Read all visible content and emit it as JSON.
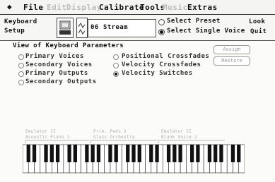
{
  "menu": {
    "apple": "◆",
    "items": [
      {
        "label": "File",
        "enabled": true
      },
      {
        "label": "Edit",
        "enabled": false
      },
      {
        "label": "Display",
        "enabled": false
      },
      {
        "label": "Calibrate",
        "enabled": true
      },
      {
        "label": "Tools",
        "enabled": true
      },
      {
        "label": "Music",
        "enabled": false
      },
      {
        "label": "Extras",
        "enabled": true
      }
    ]
  },
  "strip": {
    "setup_line1": "Keyboard",
    "setup_line2": "Setup",
    "stream_number": "06",
    "stream_label": "Stream",
    "select_preset": "Select Preset",
    "select_voice": "Select Single Voice",
    "voice_mode_selected": "single",
    "look_label": "Look",
    "quit_label": "Quit"
  },
  "panel": {
    "title": "View of Keyboard Parameters",
    "left_options": [
      "Primary Voices",
      "Secondary Voices",
      "Primary Outputs",
      "Secondary Outputs"
    ],
    "right_options": [
      "Positional Crossfades",
      "Velocity Crossfades",
      "Velocity Switches"
    ],
    "selected_option": "Velocity Switches",
    "buttons": [
      "Assign",
      "Restore"
    ]
  },
  "zones": [
    {
      "line1": "Emulator II",
      "line2": "Acoustic Piano 1"
    },
    {
      "line1": "Prim. Pads 2",
      "line2": "Glass Orchestra"
    },
    {
      "line1": "Emulator II",
      "line2": "Blank Voice 2"
    }
  ],
  "colors": {
    "background": "#fbfbf9",
    "key_black": "#111111",
    "key_white": "#ffffff"
  }
}
